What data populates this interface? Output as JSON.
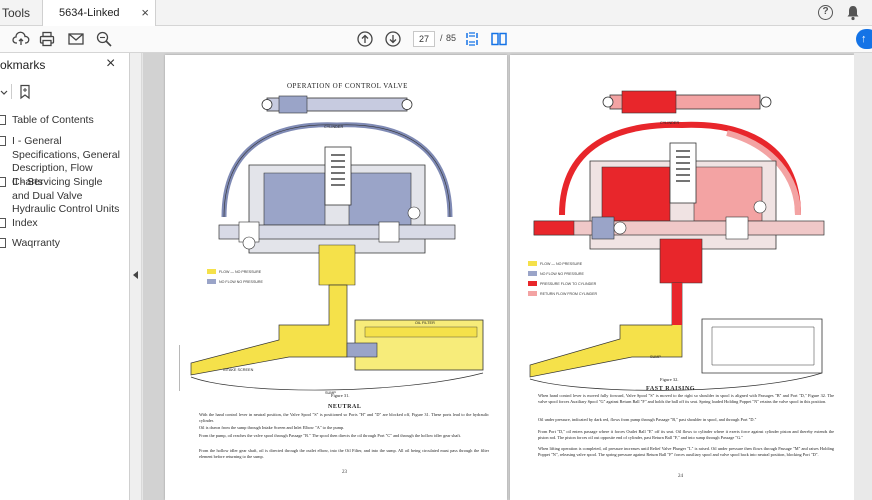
{
  "tabs": {
    "tools_label": "Tools",
    "doc_title": "5634-Linked pdf.pdf",
    "close_glyph": "×"
  },
  "toolbar": {
    "current_page": "27",
    "separator": "/",
    "total_pages": "85",
    "sign_glyph": "↑"
  },
  "sidebar": {
    "title": "okmarks",
    "close_glyph": "×",
    "items": [
      {
        "label": "Table of Contents"
      },
      {
        "label": "I - General Specifications, General Description, Flow Charts"
      },
      {
        "label": "II - Servicing Single and Dual Valve Hydraulic Control Units"
      },
      {
        "label": "Index"
      },
      {
        "label": "Waqrranty"
      }
    ]
  },
  "left_page": {
    "heading": "OPERATION OF CONTROL VALVE",
    "cylinder_label": "CYLINDER",
    "legend": [
      "FLOW — NO PRESSURE",
      "NO FLOW NO PRESSURE"
    ],
    "legend_colors": [
      "#f5e14a",
      "#9aa4c8"
    ],
    "oil_filter_label": "OIL FILTER",
    "sump_label": "SUMP",
    "screen_label": "INTAKE SCREEN",
    "figure": "Figure 31.",
    "section": "NEUTRAL",
    "paragraphs": [
      "With the hand control lever in neutral position, the Valve Spool \"S\" is positioned so Ports \"H\" and \"D\" are blocked off, Figure 31. These ports lead to the hydraulic cylinder.",
      "Oil is drawn from the sump through Intake Screen and Inlet Elbow \"A\" to the pump.",
      "From the pump, oil reaches the valve spool through Passage \"B.\" The spool then directs the oil through Port \"C\" and through the hollow idler gear shaft.",
      "From the hollow idler gear shaft, oil is directed through the outlet elbow, into the Oil Filter, and into the sump. All oil being circulated must pass through the filter element before returning to the sump."
    ],
    "page_number": "23"
  },
  "right_page": {
    "cylinder_label": "CYLINDER",
    "legend": [
      "FLOW — NO PRESSURE",
      "NO FLOW NO PRESSURE",
      "PRESSURE FLOW TO CYLINDER",
      "RETURN FLOW FROM CYLINDER"
    ],
    "legend_colors": [
      "#f5e14a",
      "#9aa4c8",
      "#e8262b",
      "#f3a3a3"
    ],
    "sump_label": "SUMP",
    "figure": "Figure 32.",
    "section": "FAST RAISING",
    "paragraphs": [
      "When hand control lever is moved fully forward, Valve Spool \"S\" is moved to the right so shoulder in spool is aligned with Passages \"B\" and Port \"D,\" Figure 32. The valve spool forces Auxiliary Spool \"G\" against Return Ball \"F\" and holds the ball off its seat. Spring loaded Holding Poppet \"N\" retains the valve spool in this position.",
      "Oil under pressure, indicated by dark red, flows from pump through Passage \"B,\" past shoulder in spool, and through Port \"D.\"",
      "From Port \"D,\" oil enters passage where it forces Outlet Ball \"E\" off its seat. Oil flows to cylinder where it exerts force against cylinder piston and thereby extends the piston rod. The piston forces oil out opposite end of cylinder, past Return Ball \"F,\" and into sump through Passage \"G.\"",
      "When lifting operation is completed, oil pressure increases until Relief Valve Plunger \"L\" is raised. Oil under pressure then flows through Passage \"M\" and raises Holding Poppet \"N\", releasing valve spool. The spring pressure against Return Ball \"F\" forces auxiliary spool and valve spool back into neutral position, blocking Port \"D\"."
    ],
    "page_number": "24"
  },
  "colors": {
    "yellow": "#f5e14a",
    "blue_gray": "#9aa4c8",
    "red": "#e8262b",
    "pink": "#f3a3a3",
    "accent": "#1473e6"
  }
}
